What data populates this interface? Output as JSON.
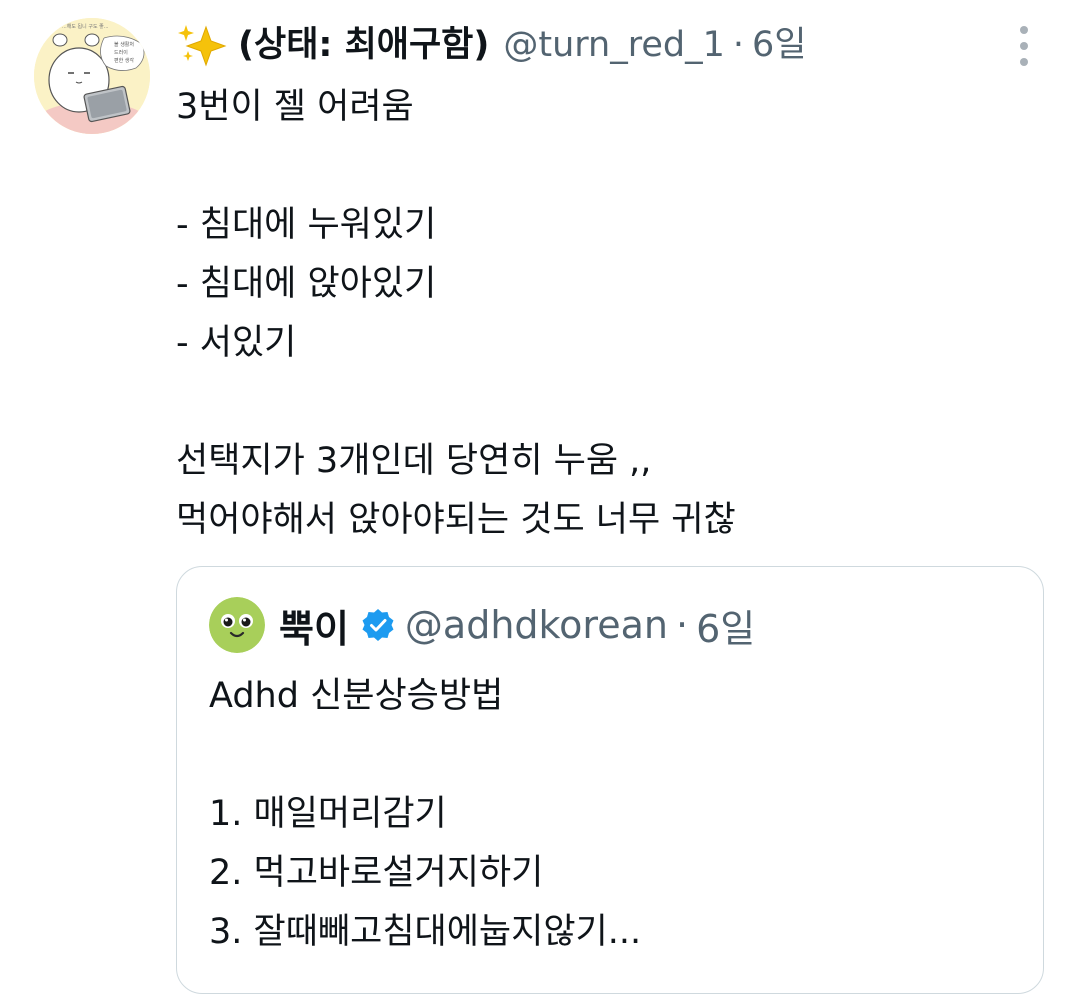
{
  "tweet": {
    "display_name": "(상태: 최애구함)",
    "handle": "@turn_red_1",
    "separator": "·",
    "time": "6일",
    "lines": [
      "3번이 젤 어려움",
      "",
      "- 침대에 누워있기",
      "- 침대에 앉아있기",
      "- 서있기",
      "",
      "선택지가 3개인데 당연히 누움 ,,",
      "먹어야해서 앉아야되는 것도 너무 귀찮"
    ]
  },
  "quote": {
    "display_name": "뿍이",
    "handle": "@adhdkorean",
    "separator": "·",
    "time": "6일",
    "lines": [
      "Adhd 신분상승방법",
      "",
      "1. 매일머리감기",
      "2. 먹고바로설거지하기",
      "3. 잘때빼고침대에눕지않기..."
    ]
  },
  "avatar_doodle_text": [
    "...해도 됩니 구도 좋...",
    "볼 생활처",
    "드러이",
    "편한 생각"
  ],
  "colors": {
    "text_primary": "#0f1419",
    "text_secondary": "#536471",
    "border": "#cfd9de",
    "verified": "#1d9bf0",
    "avatar_bg": "#fbf2c6",
    "quote_avatar_bg": "#a8cf5a"
  },
  "icons": {
    "sparkle": "sparkles-emoji-icon",
    "more": "more-options-vertical-icon",
    "verified": "verified-badge-icon"
  }
}
